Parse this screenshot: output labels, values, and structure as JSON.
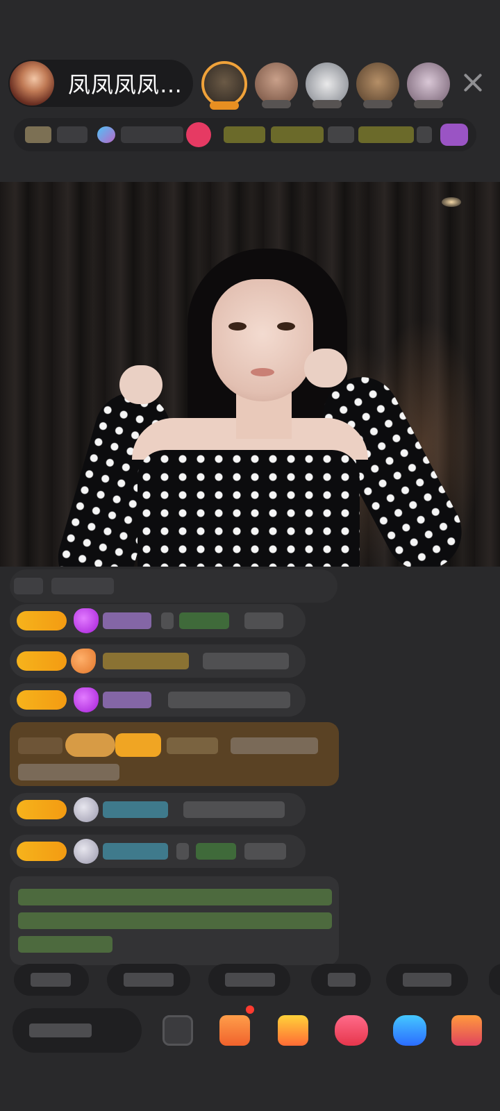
{
  "header": {
    "host_name": "凤凤凤凤…",
    "close_icon": "close-icon"
  },
  "colors": {
    "background": "#29292b",
    "badge_gold": "#f6b31c",
    "top_viewer_ring": "#f0a23a",
    "notification_dot": "#ff3b30"
  },
  "icons": [
    "close-icon",
    "gift-box-icon",
    "red-packet-icon",
    "heart-icon",
    "share-icon",
    "more-icon"
  ]
}
